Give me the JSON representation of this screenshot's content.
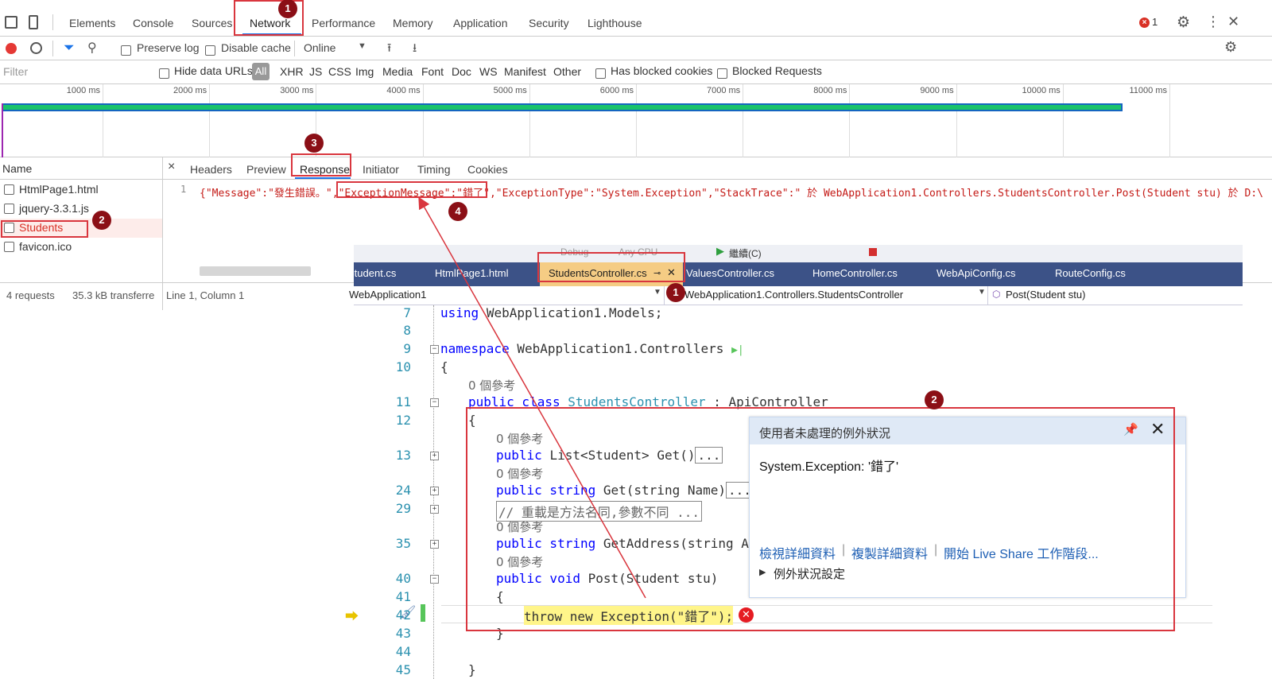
{
  "devtools": {
    "tabs": [
      "Elements",
      "Console",
      "Sources",
      "Network",
      "Performance",
      "Memory",
      "Application",
      "Security",
      "Lighthouse"
    ],
    "error_count": "1",
    "toolbar": {
      "preserve_log": "Preserve log",
      "disable_cache": "Disable cache",
      "throttle": "Online"
    },
    "filter": {
      "placeholder": "Filter",
      "hide_data_urls": "Hide data URLs",
      "types": [
        "All",
        "XHR",
        "JS",
        "CSS",
        "Img",
        "Media",
        "Font",
        "Doc",
        "WS",
        "Manifest",
        "Other"
      ],
      "has_blocked_cookies": "Has blocked cookies",
      "blocked_requests": "Blocked Requests"
    },
    "timeline_ticks": [
      "1000 ms",
      "2000 ms",
      "3000 ms",
      "4000 ms",
      "5000 ms",
      "6000 ms",
      "7000 ms",
      "8000 ms",
      "9000 ms",
      "10000 ms",
      "11000 ms"
    ],
    "name_header": "Name",
    "requests": [
      "HtmlPage1.html",
      "jquery-3.3.1.js",
      "Students",
      "favicon.ico"
    ],
    "detail_tabs": [
      "Headers",
      "Preview",
      "Response",
      "Initiator",
      "Timing",
      "Cookies"
    ],
    "close": "×",
    "response_line_no": "1",
    "response_text": {
      "p1": "{\"Message\":\"發生錯誤。\",",
      "p2": "\"ExceptionMessage\":\"錯了\"",
      "p3": ",\"ExceptionType\":\"System.Exception\",\"StackTrace\":\"   於 WebApplication1.Controllers.StudentsController.Post(Student stu) 於 D:\\"
    },
    "status": {
      "requests": "4 requests",
      "transferred": "35.3 kB transferre",
      "position": "Line 1, Column 1"
    }
  },
  "badges": [
    "1",
    "2",
    "3",
    "4"
  ],
  "vs": {
    "toolbar": {
      "config": "Debug",
      "cpu": "Any CPU",
      "run": "繼續(C)"
    },
    "tabs": [
      "Student.cs",
      "HtmlPage1.html",
      "StudentsController.cs",
      "ValuesController.cs",
      "HomeController.cs",
      "WebApiConfig.cs",
      "RouteConfig.cs"
    ],
    "nav": {
      "project": "WebApplication1",
      "class": "WebApplication1.Controllers.StudentsController",
      "method": "Post(Student stu)"
    },
    "line_numbers": [
      "7",
      "8",
      "9",
      "10",
      "11",
      "12",
      "13",
      "24",
      "29",
      "35",
      "40",
      "41",
      "42",
      "43",
      "44",
      "45"
    ],
    "code": {
      "using_kw": "using",
      "using_ns": "WebApplication1.Models;",
      "ns_kw": "namespace",
      "ns_name": "WebApplication1.Controllers",
      "ref0": "0 個參考",
      "class_line1": "public class",
      "class_name": "StudentsController",
      "class_base": ": ApiController",
      "brace_open": "{",
      "brace_close": "}",
      "get1_kw": "public",
      "get1_type": "List<Student>",
      "get1_rest": "Get()",
      "ellipsis": "...",
      "get2_kw": "public string",
      "get2_rest": "Get(string Name)",
      "comment": "// 重載是方法名同,參數不同 ...",
      "addr_kw": "public string",
      "addr_rest": "GetAddress(string Ad",
      "post_kw": "public void",
      "post_rest": "Post(Student stu)",
      "throw_line": "throw new Exception(\"錯了\");"
    },
    "popup": {
      "title": "使用者未處理的例外狀況",
      "message": "System.Exception: '錯了'",
      "link1": "檢視詳細資料",
      "link2": "複製詳細資料",
      "link3": "開始 Live Share 工作階段...",
      "settings": "例外狀況設定"
    }
  }
}
